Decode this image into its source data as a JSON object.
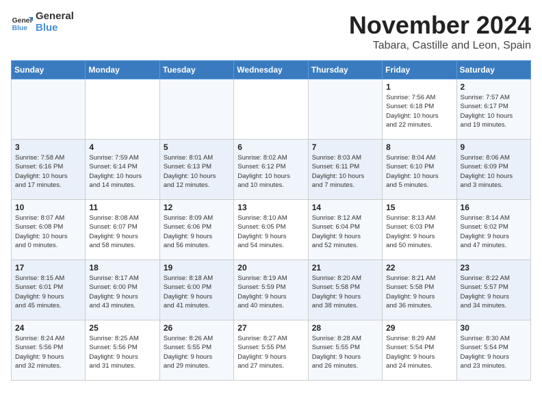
{
  "header": {
    "logo_line1": "General",
    "logo_line2": "Blue",
    "month": "November 2024",
    "location": "Tabara, Castille and Leon, Spain"
  },
  "weekdays": [
    "Sunday",
    "Monday",
    "Tuesday",
    "Wednesday",
    "Thursday",
    "Friday",
    "Saturday"
  ],
  "weeks": [
    [
      {
        "day": "",
        "info": ""
      },
      {
        "day": "",
        "info": ""
      },
      {
        "day": "",
        "info": ""
      },
      {
        "day": "",
        "info": ""
      },
      {
        "day": "",
        "info": ""
      },
      {
        "day": "1",
        "info": "Sunrise: 7:56 AM\nSunset: 6:18 PM\nDaylight: 10 hours\nand 22 minutes."
      },
      {
        "day": "2",
        "info": "Sunrise: 7:57 AM\nSunset: 6:17 PM\nDaylight: 10 hours\nand 19 minutes."
      }
    ],
    [
      {
        "day": "3",
        "info": "Sunrise: 7:58 AM\nSunset: 6:16 PM\nDaylight: 10 hours\nand 17 minutes."
      },
      {
        "day": "4",
        "info": "Sunrise: 7:59 AM\nSunset: 6:14 PM\nDaylight: 10 hours\nand 14 minutes."
      },
      {
        "day": "5",
        "info": "Sunrise: 8:01 AM\nSunset: 6:13 PM\nDaylight: 10 hours\nand 12 minutes."
      },
      {
        "day": "6",
        "info": "Sunrise: 8:02 AM\nSunset: 6:12 PM\nDaylight: 10 hours\nand 10 minutes."
      },
      {
        "day": "7",
        "info": "Sunrise: 8:03 AM\nSunset: 6:11 PM\nDaylight: 10 hours\nand 7 minutes."
      },
      {
        "day": "8",
        "info": "Sunrise: 8:04 AM\nSunset: 6:10 PM\nDaylight: 10 hours\nand 5 minutes."
      },
      {
        "day": "9",
        "info": "Sunrise: 8:06 AM\nSunset: 6:09 PM\nDaylight: 10 hours\nand 3 minutes."
      }
    ],
    [
      {
        "day": "10",
        "info": "Sunrise: 8:07 AM\nSunset: 6:08 PM\nDaylight: 10 hours\nand 0 minutes."
      },
      {
        "day": "11",
        "info": "Sunrise: 8:08 AM\nSunset: 6:07 PM\nDaylight: 9 hours\nand 58 minutes."
      },
      {
        "day": "12",
        "info": "Sunrise: 8:09 AM\nSunset: 6:06 PM\nDaylight: 9 hours\nand 56 minutes."
      },
      {
        "day": "13",
        "info": "Sunrise: 8:10 AM\nSunset: 6:05 PM\nDaylight: 9 hours\nand 54 minutes."
      },
      {
        "day": "14",
        "info": "Sunrise: 8:12 AM\nSunset: 6:04 PM\nDaylight: 9 hours\nand 52 minutes."
      },
      {
        "day": "15",
        "info": "Sunrise: 8:13 AM\nSunset: 6:03 PM\nDaylight: 9 hours\nand 50 minutes."
      },
      {
        "day": "16",
        "info": "Sunrise: 8:14 AM\nSunset: 6:02 PM\nDaylight: 9 hours\nand 47 minutes."
      }
    ],
    [
      {
        "day": "17",
        "info": "Sunrise: 8:15 AM\nSunset: 6:01 PM\nDaylight: 9 hours\nand 45 minutes."
      },
      {
        "day": "18",
        "info": "Sunrise: 8:17 AM\nSunset: 6:00 PM\nDaylight: 9 hours\nand 43 minutes."
      },
      {
        "day": "19",
        "info": "Sunrise: 8:18 AM\nSunset: 6:00 PM\nDaylight: 9 hours\nand 41 minutes."
      },
      {
        "day": "20",
        "info": "Sunrise: 8:19 AM\nSunset: 5:59 PM\nDaylight: 9 hours\nand 40 minutes."
      },
      {
        "day": "21",
        "info": "Sunrise: 8:20 AM\nSunset: 5:58 PM\nDaylight: 9 hours\nand 38 minutes."
      },
      {
        "day": "22",
        "info": "Sunrise: 8:21 AM\nSunset: 5:58 PM\nDaylight: 9 hours\nand 36 minutes."
      },
      {
        "day": "23",
        "info": "Sunrise: 8:22 AM\nSunset: 5:57 PM\nDaylight: 9 hours\nand 34 minutes."
      }
    ],
    [
      {
        "day": "24",
        "info": "Sunrise: 8:24 AM\nSunset: 5:56 PM\nDaylight: 9 hours\nand 32 minutes."
      },
      {
        "day": "25",
        "info": "Sunrise: 8:25 AM\nSunset: 5:56 PM\nDaylight: 9 hours\nand 31 minutes."
      },
      {
        "day": "26",
        "info": "Sunrise: 8:26 AM\nSunset: 5:55 PM\nDaylight: 9 hours\nand 29 minutes."
      },
      {
        "day": "27",
        "info": "Sunrise: 8:27 AM\nSunset: 5:55 PM\nDaylight: 9 hours\nand 27 minutes."
      },
      {
        "day": "28",
        "info": "Sunrise: 8:28 AM\nSunset: 5:55 PM\nDaylight: 9 hours\nand 26 minutes."
      },
      {
        "day": "29",
        "info": "Sunrise: 8:29 AM\nSunset: 5:54 PM\nDaylight: 9 hours\nand 24 minutes."
      },
      {
        "day": "30",
        "info": "Sunrise: 8:30 AM\nSunset: 5:54 PM\nDaylight: 9 hours\nand 23 minutes."
      }
    ]
  ]
}
